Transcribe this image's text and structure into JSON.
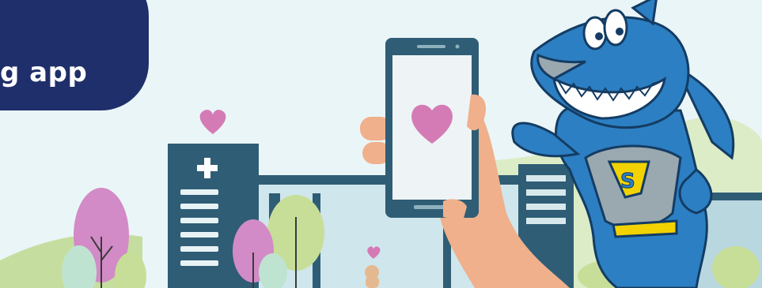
{
  "banner": {
    "title": "g app",
    "colors": {
      "navy": "#1f2f6b",
      "sky": "#eaf5f8",
      "hill": "#c9e0a8",
      "heart": "#d47bb6",
      "shark": "#2c7fc2"
    }
  }
}
